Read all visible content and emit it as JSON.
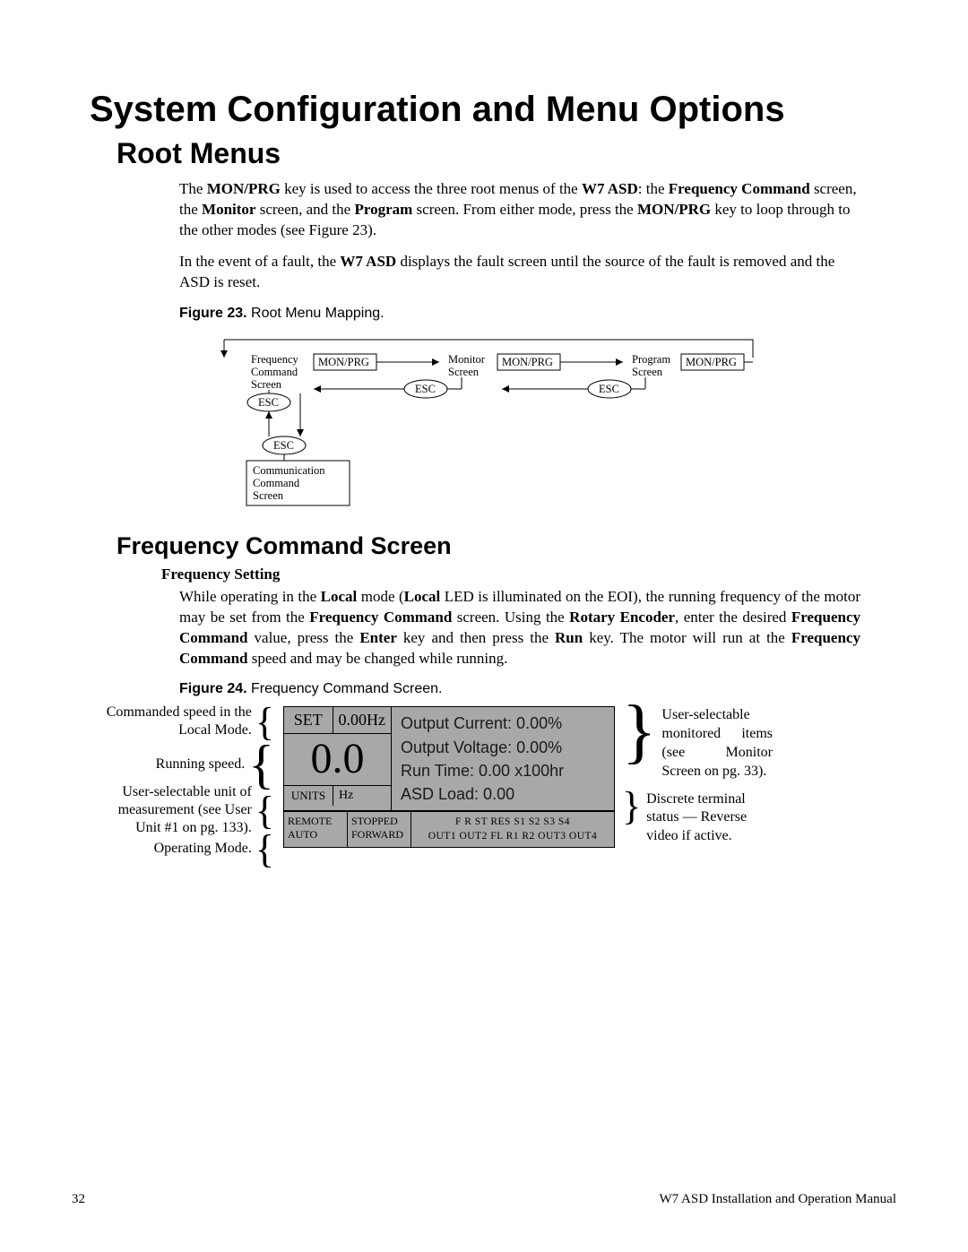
{
  "title": "System Configuration and Menu Options",
  "section1": {
    "heading": "Root Menus",
    "p1_a": "The ",
    "p1_b": "MON/PRG",
    "p1_c": " key is used to access the three root menus of the ",
    "p1_d": "W7 ASD",
    "p1_e": ": the ",
    "p1_f": "Frequency Command",
    "p1_g": " screen, the ",
    "p1_h": "Monitor",
    "p1_i": " screen, and the ",
    "p1_j": "Program",
    "p1_k": " screen. From either mode, press the ",
    "p1_l": "MON/PRG",
    "p1_m": " key to loop through to the other modes (see Figure 23).",
    "p2_a": "In the event of a fault, the ",
    "p2_b": "W7 ASD",
    "p2_c": " displays the fault screen until the source of the fault is removed and the ASD is reset.",
    "fig23_label": "Figure 23.",
    "fig23_caption": " Root Menu Mapping.",
    "diagram": {
      "freq_cmd": "Frequency\nCommand\nScreen",
      "monitor": "Monitor\nScreen",
      "program": "Program\nScreen",
      "comm": "Communication\nCommand\nScreen",
      "monprg": "MON/PRG",
      "esc": "ESC"
    }
  },
  "section2": {
    "heading": "Frequency Command Screen",
    "sub_heading": "Frequency Setting",
    "p1_a": "While operating in the ",
    "p1_b": "Local",
    "p1_c": " mode (",
    "p1_d": "Local",
    "p1_e": " LED is illuminated on the EOI), the running frequency of the motor may be set from the ",
    "p1_f": "Frequency Command",
    "p1_g": " screen. Using the ",
    "p1_h": "Rotary Encoder",
    "p1_i": ", enter the desired ",
    "p1_j": "Frequency Command",
    "p1_k": " value, press the ",
    "p1_l": "Enter",
    "p1_m": " key and then press the ",
    "p1_n": "Run",
    "p1_o": " key. The motor will run at the ",
    "p1_p": "Frequency Command",
    "p1_q": " speed and may be changed while running.",
    "fig24_label": "Figure 24.",
    "fig24_caption": " Frequency Command Screen.",
    "callouts_left": {
      "c1": "Commanded speed in the Local Mode.",
      "c2": "Running speed.",
      "c3": "User-selectable unit of measurement (see User Unit #1 on pg. 133).",
      "c4": "Operating Mode."
    },
    "screen": {
      "set_label": "SET",
      "set_value": "0.00Hz",
      "big_number": "0.0",
      "units_label": "UNITS",
      "units_value": "Hz",
      "line1": "Output Current: 0.00%",
      "line2": "Output Voltage: 0.00%",
      "line3": "Run Time: 0.00 x100hr",
      "line4": "ASD Load: 0.00",
      "mode1a": "REMOTE",
      "mode1b": "AUTO",
      "mode2a": "STOPPED",
      "mode2b": "FORWARD",
      "terms1": "F  R  ST  RES  S1  S2  S3  S4",
      "terms2": "OUT1  OUT2  FL  R1  R2  OUT3  OUT4"
    },
    "callouts_right": {
      "c1": "User-selectable monitored items (see Monitor Screen on pg. 33).",
      "c2": "Discrete terminal status — Reverse video if active."
    }
  },
  "footer": {
    "page_num": "32",
    "doc_title": "W7 ASD Installation and Operation Manual"
  }
}
